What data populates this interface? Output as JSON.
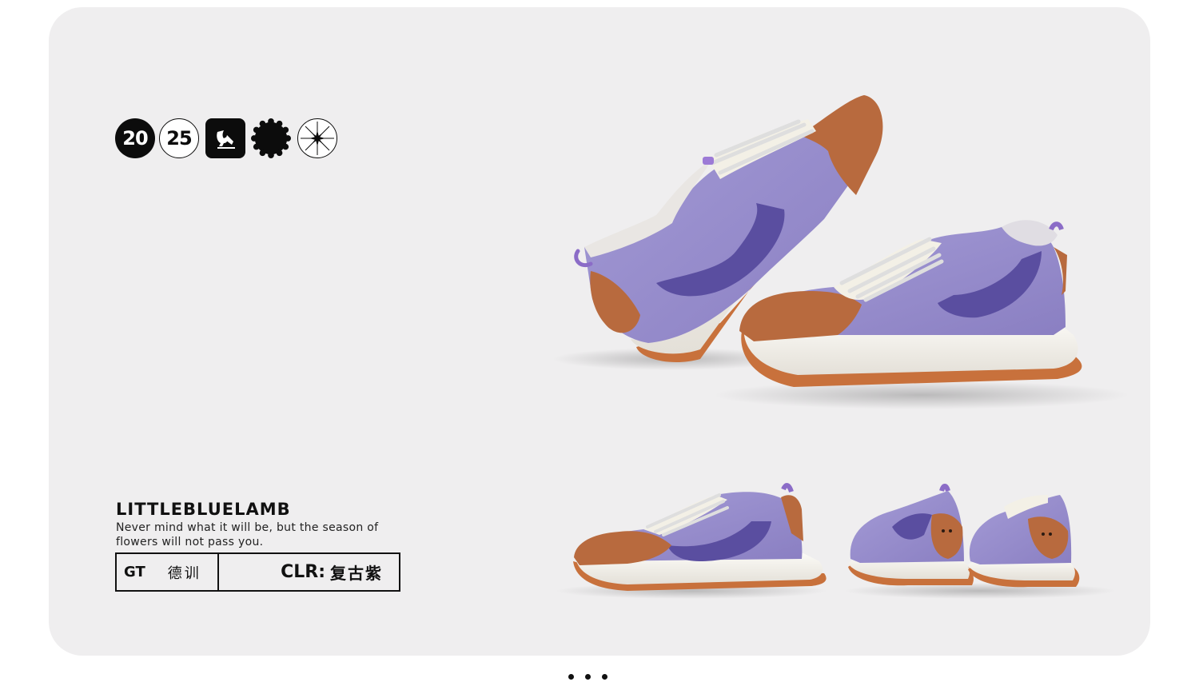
{
  "badges": {
    "year_part1": "20",
    "year_part2": "25"
  },
  "brand": {
    "name": "LittleBlueLamb",
    "tagline": "Never mind what it will be, but the season of flowers will not pass you."
  },
  "info": {
    "code": "GT",
    "series_cn": "德训",
    "color_label": "CLR:",
    "color_value": "复古紫"
  },
  "colors": {
    "card_bg": "#efeeef",
    "upper_purple": "#8f84c6",
    "swoosh_purple": "#5a4ea0",
    "leather_brown": "#b86a3e",
    "sole_white": "#f2efe9",
    "outsole_orange": "#c8713c"
  },
  "pager": {
    "dots": 3
  }
}
